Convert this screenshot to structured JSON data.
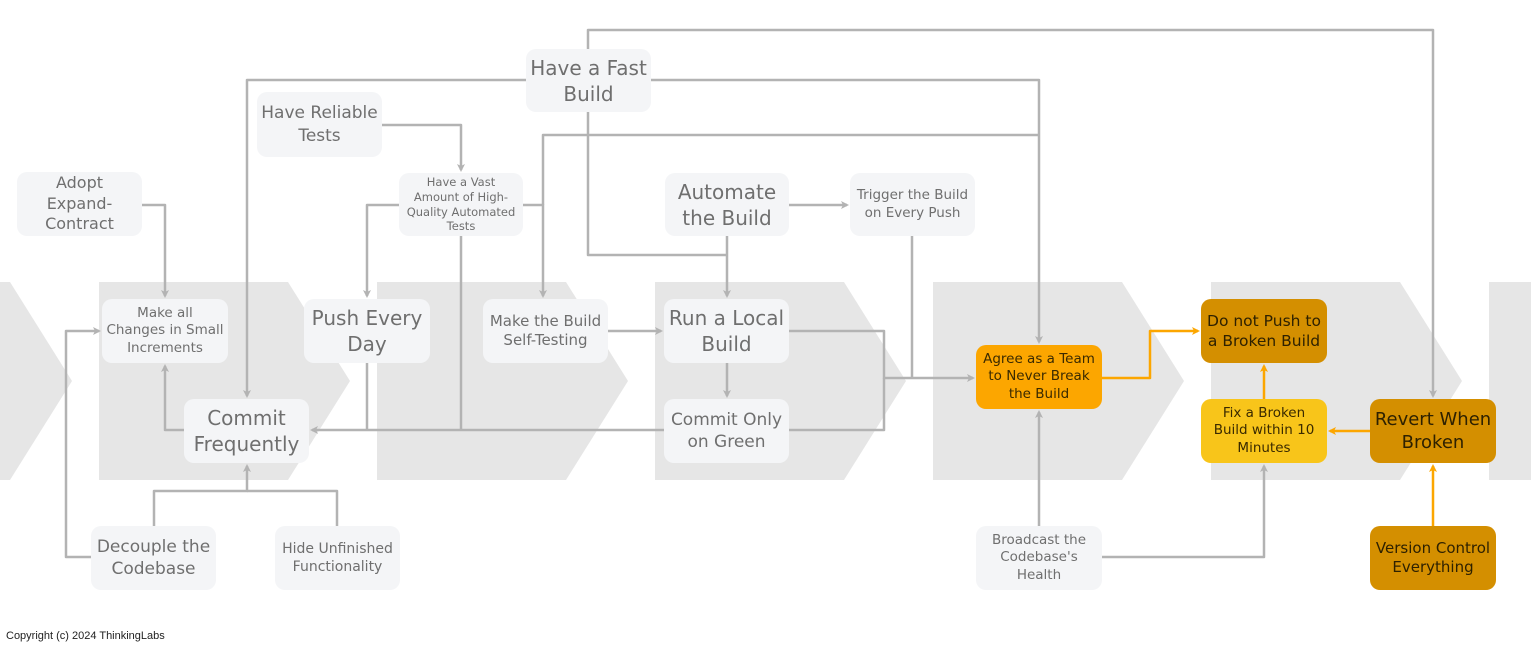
{
  "colors": {
    "stage_bg": "#e6e6e6",
    "node_bg": "#f4f5f7",
    "connector": "#b3b3b3",
    "highlight_connector": "#fca600",
    "agree": "#fca600",
    "dark_orange": "#d48f00",
    "yellow": "#f8c51a"
  },
  "nodes": {
    "fast_build": "Have a Fast Build",
    "reliable_tests": "Have Reliable Tests",
    "expand_contract": "Adopt Expand-Contract",
    "vast_tests": "Have a Vast Amount of High-Quality Automated Tests",
    "automate_build": "Automate the Build",
    "trigger_build": "Trigger the Build on Every Push",
    "small_increments": "Make all Changes in Small Increments",
    "push_every_day": "Push Every Day",
    "self_testing": "Make the Build Self-Testing",
    "local_build": "Run a Local Build",
    "commit_frequently": "Commit Frequently",
    "commit_green": "Commit Only on Green",
    "agree_team": "Agree as a Team to Never Break the Build",
    "no_push_broken": "Do not Push to a Broken Build",
    "fix_broken": "Fix a Broken Build within 10 Minutes",
    "revert": "Revert When Broken",
    "version_control": "Version Control Everything",
    "decouple": "Decouple the Codebase",
    "hide_unfinished": "Hide Unfinished Functionality",
    "broadcast": "Broadcast the Codebase's Health"
  },
  "copyright": "Copyright (c) 2024 ThinkingLabs"
}
